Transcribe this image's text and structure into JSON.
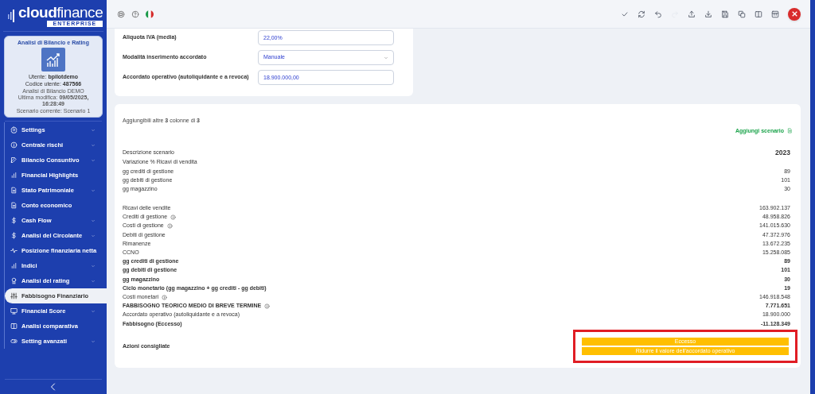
{
  "sidebar": {
    "logo": {
      "text": "**cloud**finance",
      "subtitle": "ENTERPRISE"
    },
    "profile": {
      "title": "Analisi di Bilancio e Rating",
      "user": "Utente: **bpilotdemo**",
      "code": "Codice utente: **487566**",
      "analysis": "Analisi di Bilancio DEMO",
      "modified": "Ultima modifica: **09/05/2025, 16:28:49**",
      "scenario": "Scenario corrente: Scenario 1"
    },
    "items": [
      {
        "label": "Settings",
        "kind": "gear",
        "expandable": true,
        "selected": false
      },
      {
        "label": "Centrale rischi",
        "kind": "info",
        "expandable": true,
        "selected": false
      },
      {
        "label": "Bilancio Consuntivo",
        "kind": "edit",
        "expandable": true,
        "selected": false
      },
      {
        "label": "Financial Highlights",
        "kind": "bars",
        "expandable": false,
        "selected": false
      },
      {
        "label": "Stato Patrimoniale",
        "kind": "doc",
        "expandable": true,
        "selected": false
      },
      {
        "label": "Conto economico",
        "kind": "doc",
        "expandable": false,
        "selected": false
      },
      {
        "label": "Cash Flow",
        "kind": "dollar",
        "expandable": true,
        "selected": false
      },
      {
        "label": "Analisi del Circolante",
        "kind": "dollar",
        "expandable": true,
        "selected": false
      },
      {
        "label": "Posizione finanziaria netta",
        "kind": "pulse",
        "expandable": false,
        "selected": false
      },
      {
        "label": "Indici",
        "kind": "bars",
        "expandable": true,
        "selected": false
      },
      {
        "label": "Analisi del rating",
        "kind": "award",
        "expandable": true,
        "selected": false
      },
      {
        "label": "Fabbisogno Finanziario",
        "kind": "sliders",
        "expandable": false,
        "selected": true
      },
      {
        "label": "Financial Score",
        "kind": "monitor",
        "expandable": true,
        "selected": false
      },
      {
        "label": "Analisi comparativa",
        "kind": "columns",
        "expandable": false,
        "selected": false
      },
      {
        "label": "Setting avanzati",
        "kind": "toggle",
        "expandable": true,
        "selected": false
      }
    ]
  },
  "topbar": {
    "left_icons": [
      {
        "kind": "support"
      },
      {
        "kind": "help"
      },
      {
        "kind": "flag"
      }
    ],
    "tools": [
      {
        "kind": "check",
        "disabled": false
      },
      {
        "kind": "refresh",
        "disabled": false
      },
      {
        "kind": "undo",
        "disabled": false
      },
      {
        "kind": "redo",
        "disabled": true
      },
      {
        "kind": "upload",
        "disabled": false
      },
      {
        "kind": "download",
        "disabled": false
      },
      {
        "kind": "save",
        "disabled": false
      },
      {
        "kind": "copy",
        "disabled": false
      },
      {
        "kind": "columns",
        "disabled": false
      },
      {
        "kind": "panel",
        "disabled": false
      }
    ]
  },
  "form": [
    {
      "label": "Aliquota IVA (media)",
      "kind": "input",
      "value": "22,00%"
    },
    {
      "label": "Modalità inserimento accordato",
      "kind": "select",
      "value": "Manuale"
    },
    {
      "label": "Accordato operativo (autoliquidante e a revoca)",
      "kind": "input",
      "value": "18.900.000,00"
    }
  ],
  "table": {
    "note": "Aggiungibili altre **3** colonne di **3**",
    "add_button": "Aggiungi scenario",
    "sections": [
      [
        {
          "label": "Descrizione scenario",
          "value": "2023",
          "bold": false,
          "header": true,
          "info": false
        },
        {
          "label": "Variazione % Ricavi di vendita",
          "bold": false,
          "header": false,
          "info": false
        },
        {
          "label": "gg crediti di gestione",
          "value": "89",
          "bold": false,
          "header": false,
          "info": false
        },
        {
          "label": "gg debiti di gestione",
          "value": "101",
          "bold": false,
          "header": false,
          "info": false
        },
        {
          "label": "gg magazzino",
          "value": "30",
          "bold": false,
          "header": false,
          "info": false
        }
      ],
      [
        {
          "label": "Ricavi delle vendite",
          "value": "163.902.137",
          "bold": false,
          "header": false,
          "info": false
        },
        {
          "label": "Crediti di gestione",
          "value": "48.958.826",
          "bold": false,
          "header": false,
          "info": true
        },
        {
          "label": "Costi di gestione",
          "value": "141.015.630",
          "bold": false,
          "header": false,
          "info": true
        },
        {
          "label": "Debiti di gestione",
          "value": "47.372.976",
          "bold": false,
          "header": false,
          "info": false
        },
        {
          "label": "Rimanenze",
          "value": "13.672.235",
          "bold": false,
          "header": false,
          "info": false
        },
        {
          "label": "CCNO",
          "value": "15.258.085",
          "bold": false,
          "header": false,
          "info": false
        },
        {
          "label": "gg crediti di gestione",
          "value": "89",
          "bold": true,
          "header": false,
          "info": false
        },
        {
          "label": "gg debiti di gestione",
          "value": "101",
          "bold": true,
          "header": false,
          "info": false
        },
        {
          "label": "gg magazzino",
          "value": "30",
          "bold": true,
          "header": false,
          "info": false
        },
        {
          "label": "Ciclo monetario (gg magazzino + gg crediti - gg debiti)",
          "value": "19",
          "bold": true,
          "header": false,
          "info": false
        },
        {
          "label": "Costi monetari",
          "value": "146.918.548",
          "bold": false,
          "header": false,
          "info": true
        },
        {
          "label": "FABBISOGNO TEORICO MEDIO DI BREVE TERMINE",
          "value": "7.771.651",
          "bold": true,
          "header": false,
          "info": true
        },
        {
          "label": "Accordato operativo (autoliquidante e a revoca)",
          "value": "18.900.000",
          "bold": false,
          "header": false,
          "info": false
        },
        {
          "label": "Fabbisogno (Eccesso)",
          "value": "-11.128.349",
          "bold": true,
          "header": false,
          "info": false
        }
      ]
    ],
    "actions": {
      "label": "Azioni consigliate",
      "highlighted": true,
      "items": [
        "Eccesso",
        "Ridurre il valore dell'accordato operativo"
      ]
    }
  }
}
